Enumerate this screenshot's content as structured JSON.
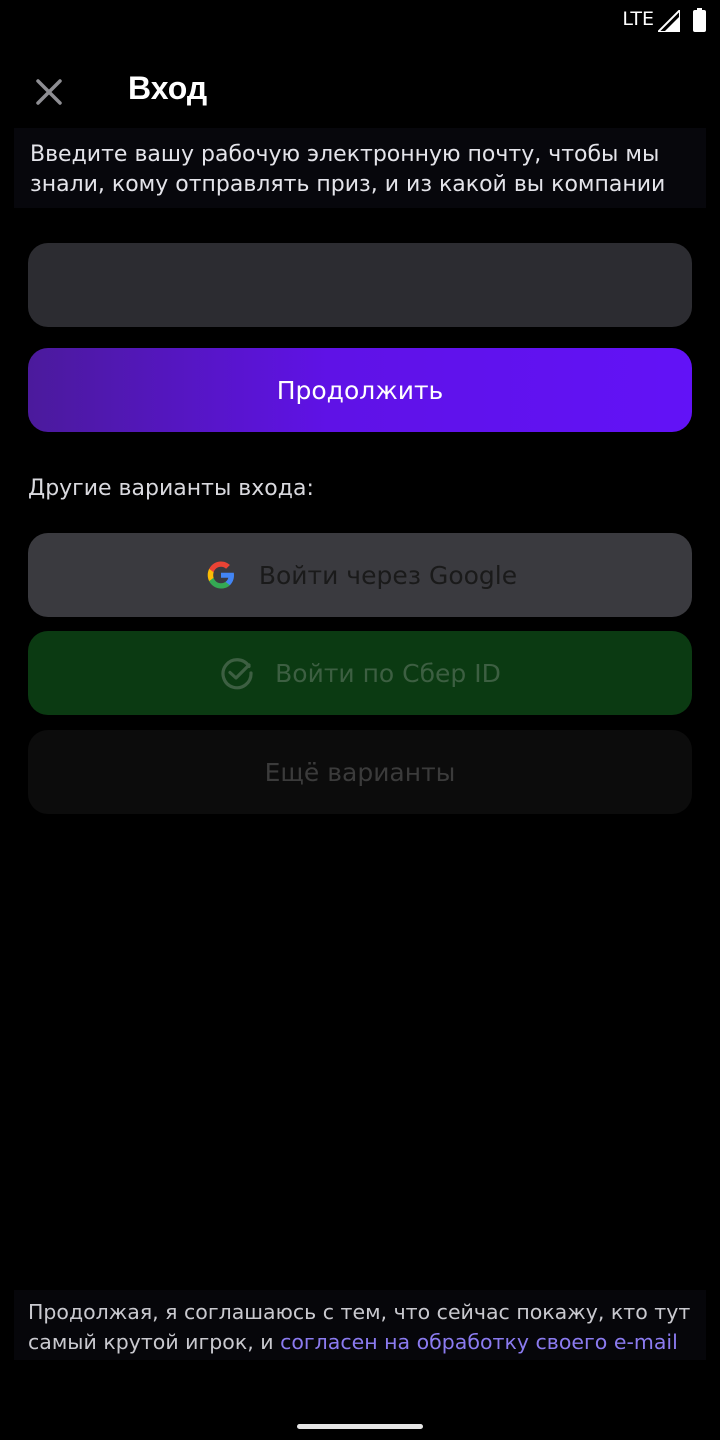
{
  "status_bar": {
    "network": "LTE"
  },
  "header": {
    "title": "Вход"
  },
  "description": {
    "line1": "Введите вашу рабочую электронную почту, чтобы мы",
    "line2": "знали, кому отправлять приз, и из какой вы компании"
  },
  "email_input": {
    "value": "",
    "placeholder": ""
  },
  "continue_button": {
    "label": "Продолжить"
  },
  "other_options": {
    "label": "Другие варианты входа:",
    "google": {
      "label": "Войти через Google",
      "icon": "google-icon"
    },
    "sber": {
      "label": "Войти по Сбер ID",
      "icon": "sber-check-icon"
    },
    "more": {
      "label": "Ещё варианты"
    }
  },
  "consent": {
    "line1": "Продолжая, я соглашаюсь с тем, что сейчас покажу, кто тут",
    "line2_prefix": "самый крутой игрок, и ",
    "link": "согласен на обработку своего e-mail"
  },
  "colors": {
    "accent": "#6212f7",
    "sber_green": "#0b3a12",
    "link": "#8b7bf0"
  }
}
